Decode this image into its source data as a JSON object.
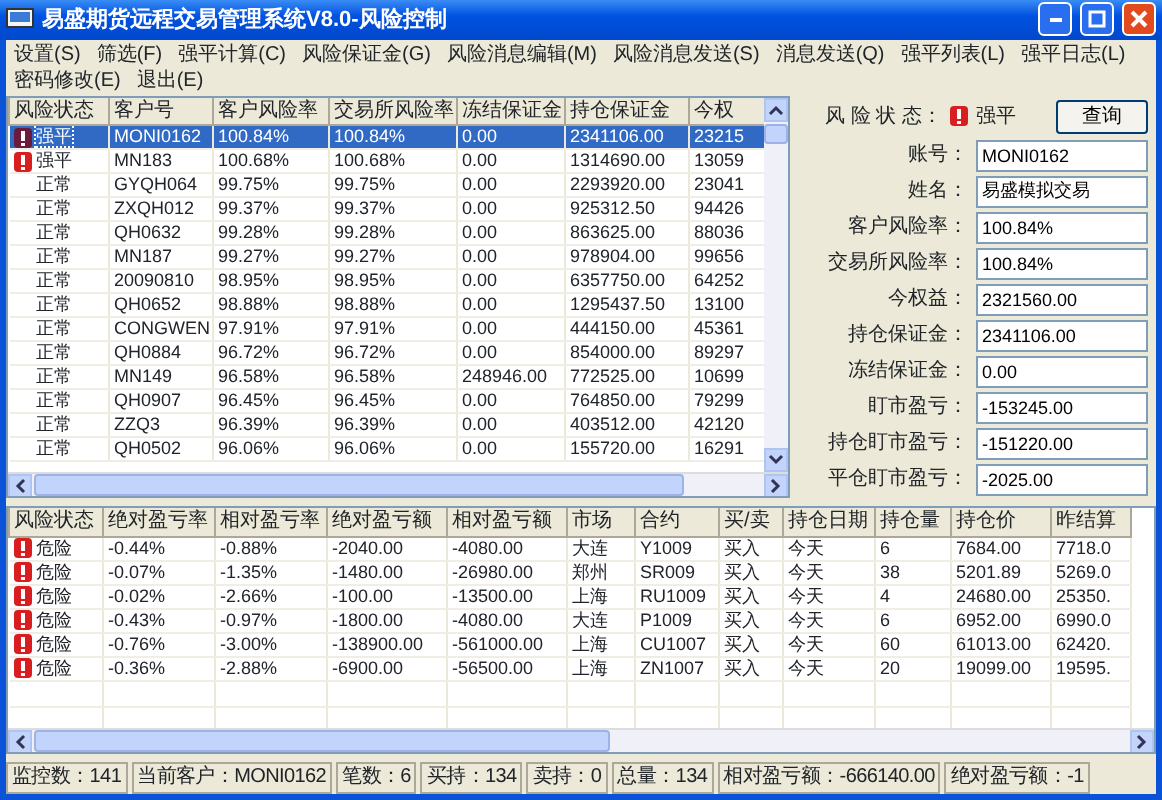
{
  "window": {
    "title": "易盛期货远程交易管理系统V8.0-风险控制"
  },
  "menu": [
    "设置(S)",
    "筛选(F)",
    "强平计算(C)",
    "风险保证金(G)",
    "风险消息编辑(M)",
    "风险消息发送(S)",
    "消息发送(Q)",
    "强平列表(L)",
    "强平日志(L)",
    "密码修改(E)",
    "退出(E)"
  ],
  "clients": {
    "columns": [
      "风险状态",
      "客户号",
      "客户风险率",
      "交易所风险率",
      "冻结保证金",
      "持仓保证金",
      "今权"
    ],
    "rows": [
      {
        "selected": true,
        "alert": true,
        "cells": [
          "强平",
          "MONI0162",
          "100.84%",
          "100.84%",
          "0.00",
          "2341106.00",
          "23215"
        ]
      },
      {
        "selected": false,
        "alert": true,
        "cells": [
          "强平",
          "MN183",
          "100.68%",
          "100.68%",
          "0.00",
          "1314690.00",
          "13059"
        ]
      },
      {
        "selected": false,
        "alert": false,
        "cells": [
          "正常",
          "GYQH064",
          "99.75%",
          "99.75%",
          "0.00",
          "2293920.00",
          "23041"
        ]
      },
      {
        "selected": false,
        "alert": false,
        "cells": [
          "正常",
          "ZXQH012",
          "99.37%",
          "99.37%",
          "0.00",
          "925312.50",
          "94426"
        ]
      },
      {
        "selected": false,
        "alert": false,
        "cells": [
          "正常",
          "QH0632",
          "99.28%",
          "99.28%",
          "0.00",
          "863625.00",
          "88036"
        ]
      },
      {
        "selected": false,
        "alert": false,
        "cells": [
          "正常",
          "MN187",
          "99.27%",
          "99.27%",
          "0.00",
          "978904.00",
          "99656"
        ]
      },
      {
        "selected": false,
        "alert": false,
        "cells": [
          "正常",
          "20090810",
          "98.95%",
          "98.95%",
          "0.00",
          "6357750.00",
          "64252"
        ]
      },
      {
        "selected": false,
        "alert": false,
        "cells": [
          "正常",
          "QH0652",
          "98.88%",
          "98.88%",
          "0.00",
          "1295437.50",
          "13100"
        ]
      },
      {
        "selected": false,
        "alert": false,
        "cells": [
          "正常",
          "CONGWEN",
          "97.91%",
          "97.91%",
          "0.00",
          "444150.00",
          "45361"
        ]
      },
      {
        "selected": false,
        "alert": false,
        "cells": [
          "正常",
          "QH0884",
          "96.72%",
          "96.72%",
          "0.00",
          "854000.00",
          "89297"
        ]
      },
      {
        "selected": false,
        "alert": false,
        "cells": [
          "正常",
          "MN149",
          "96.58%",
          "96.58%",
          "248946.00",
          "772525.00",
          "10699"
        ]
      },
      {
        "selected": false,
        "alert": false,
        "cells": [
          "正常",
          "QH0907",
          "96.45%",
          "96.45%",
          "0.00",
          "764850.00",
          "79299"
        ]
      },
      {
        "selected": false,
        "alert": false,
        "cells": [
          "正常",
          "ZZQ3",
          "96.39%",
          "96.39%",
          "0.00",
          "403512.00",
          "42120"
        ]
      },
      {
        "selected": false,
        "alert": false,
        "cells": [
          "正常",
          "QH0502",
          "96.06%",
          "96.06%",
          "0.00",
          "155720.00",
          "16291"
        ]
      }
    ]
  },
  "detail": {
    "risk_label": "风 险 状 态：",
    "risk_alert": true,
    "risk_value": "强平",
    "query_button": "查询",
    "fields": [
      {
        "label": "账号：",
        "value": "MONI0162"
      },
      {
        "label": "姓名：",
        "value": "易盛模拟交易"
      },
      {
        "label": "客户风险率：",
        "value": "100.84%"
      },
      {
        "label": "交易所风险率：",
        "value": "100.84%"
      },
      {
        "label": "今权益：",
        "value": "2321560.00"
      },
      {
        "label": "持仓保证金：",
        "value": "2341106.00"
      },
      {
        "label": "冻结保证金：",
        "value": "0.00"
      },
      {
        "label": "盯市盈亏：",
        "value": "-153245.00"
      },
      {
        "label": "持仓盯市盈亏：",
        "value": "-151220.00"
      },
      {
        "label": "平仓盯市盈亏：",
        "value": "-2025.00"
      }
    ]
  },
  "positions": {
    "columns": [
      "风险状态",
      "绝对盈亏率",
      "相对盈亏率",
      "绝对盈亏额",
      "相对盈亏额",
      "市场",
      "合约",
      "买/卖",
      "持仓日期",
      "持仓量",
      "持仓价",
      "昨结算"
    ],
    "rows": [
      {
        "alert": true,
        "cells": [
          "危险",
          "-0.44%",
          "-0.88%",
          "-2040.00",
          "-4080.00",
          "大连",
          "Y1009",
          "买入",
          "今天",
          "6",
          "7684.00",
          "7718.0"
        ]
      },
      {
        "alert": true,
        "cells": [
          "危险",
          "-0.07%",
          "-1.35%",
          "-1480.00",
          "-26980.00",
          "郑州",
          "SR009",
          "买入",
          "今天",
          "38",
          "5201.89",
          "5269.0"
        ]
      },
      {
        "alert": true,
        "cells": [
          "危险",
          "-0.02%",
          "-2.66%",
          "-100.00",
          "-13500.00",
          "上海",
          "RU1009",
          "买入",
          "今天",
          "4",
          "24680.00",
          "25350."
        ]
      },
      {
        "alert": true,
        "cells": [
          "危险",
          "-0.43%",
          "-0.97%",
          "-1800.00",
          "-4080.00",
          "大连",
          "P1009",
          "买入",
          "今天",
          "6",
          "6952.00",
          "6990.0"
        ]
      },
      {
        "alert": true,
        "cells": [
          "危险",
          "-0.76%",
          "-3.00%",
          "-138900.00",
          "-561000.00",
          "上海",
          "CU1007",
          "买入",
          "今天",
          "60",
          "61013.00",
          "62420."
        ]
      },
      {
        "alert": true,
        "cells": [
          "危险",
          "-0.36%",
          "-2.88%",
          "-6900.00",
          "-56500.00",
          "上海",
          "ZN1007",
          "买入",
          "今天",
          "20",
          "19099.00",
          "19595."
        ]
      }
    ]
  },
  "status_bar": [
    "监控数：141",
    "当前客户：MONI0162",
    "笔数：6",
    "买持：134",
    "卖持：0",
    "总量：134",
    "相对盈亏额：-666140.00",
    "绝对盈亏额：-1"
  ]
}
